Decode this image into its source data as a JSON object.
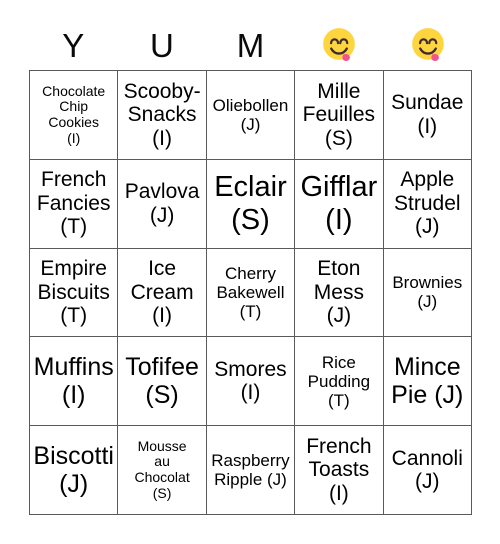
{
  "card": {
    "title_letters": [
      "Y",
      "U",
      "M",
      "😋",
      "😋"
    ],
    "header": {
      "col1": "Y",
      "col2": "U",
      "col3": "M",
      "col4": "😋",
      "col5": "😋"
    },
    "icons": {
      "col4_icon": "face-savoring-food-emoji",
      "col5_icon": "face-savoring-food-emoji"
    },
    "colors": {
      "background": "#ffffff",
      "text": "#000000",
      "grid_border": "#5a5a5a",
      "emoji_face": "#fcd53f",
      "emoji_tongue": "#f4538f"
    },
    "grid": {
      "rows": 5,
      "columns": 5,
      "cells": [
        [
          {
            "text": "Chocolate Chip Cookies (I)",
            "line1": "Chocolate",
            "line2": "Chip",
            "line3": "Cookies",
            "line4": "(I)",
            "size": "fs-xs"
          },
          {
            "text": "Scooby-Snacks (I)",
            "line1": "Scooby-",
            "line2": "Snacks",
            "line3": "(I)",
            "line4": "",
            "size": "fs-md"
          },
          {
            "text": "Oliebollen (J)",
            "line1": "Oliebollen",
            "line2": "(J)",
            "line3": "",
            "line4": "",
            "size": "fs-sm"
          },
          {
            "text": "Mille Feuilles (S)",
            "line1": "Mille",
            "line2": "Feuilles",
            "line3": "(S)",
            "line4": "",
            "size": "fs-md"
          },
          {
            "text": "Sundae (I)",
            "line1": "Sundae",
            "line2": "(I)",
            "line3": "",
            "line4": "",
            "size": "fs-md"
          }
        ],
        [
          {
            "text": "French Fancies (T)",
            "line1": "French",
            "line2": "Fancies",
            "line3": "(T)",
            "line4": "",
            "size": "fs-md"
          },
          {
            "text": "Pavlova (J)",
            "line1": "Pavlova",
            "line2": "(J)",
            "line3": "",
            "line4": "",
            "size": "fs-md"
          },
          {
            "text": "Eclair (S)",
            "line1": "Eclair",
            "line2": "(S)",
            "line3": "",
            "line4": "",
            "size": "fs-xl"
          },
          {
            "text": "Gifflar (I)",
            "line1": "Gifflar",
            "line2": "(I)",
            "line3": "",
            "line4": "",
            "size": "fs-xl"
          },
          {
            "text": "Apple Strudel (J)",
            "line1": "Apple",
            "line2": "Strudel",
            "line3": "(J)",
            "line4": "",
            "size": "fs-md"
          }
        ],
        [
          {
            "text": "Empire Biscuits (T)",
            "line1": "Empire",
            "line2": "Biscuits",
            "line3": "(T)",
            "line4": "",
            "size": "fs-md"
          },
          {
            "text": "Ice Cream (I)",
            "line1": "Ice",
            "line2": "Cream",
            "line3": "(I)",
            "line4": "",
            "size": "fs-md"
          },
          {
            "text": "Cherry Bakewell (T)",
            "line1": "Cherry",
            "line2": "Bakewell",
            "line3": "(T)",
            "line4": "",
            "size": "fs-sm"
          },
          {
            "text": "Eton Mess (J)",
            "line1": "Eton",
            "line2": "Mess",
            "line3": "(J)",
            "line4": "",
            "size": "fs-md"
          },
          {
            "text": "Brownies (J)",
            "line1": "Brownies",
            "line2": "(J)",
            "line3": "",
            "line4": "",
            "size": "fs-sm"
          }
        ],
        [
          {
            "text": "Muffins (I)",
            "line1": "Muffins",
            "line2": "(I)",
            "line3": "",
            "line4": "",
            "size": "fs-lg"
          },
          {
            "text": "Tofifee (S)",
            "line1": "Tofifee",
            "line2": "(S)",
            "line3": "",
            "line4": "",
            "size": "fs-lg"
          },
          {
            "text": "Smores (I)",
            "line1": "Smores",
            "line2": "(I)",
            "line3": "",
            "line4": "",
            "size": "fs-md"
          },
          {
            "text": "Rice Pudding (T)",
            "line1": "Rice",
            "line2": "Pudding",
            "line3": "(T)",
            "line4": "",
            "size": "fs-sm"
          },
          {
            "text": "Mince Pie (J)",
            "line1": "Mince",
            "line2": "Pie (J)",
            "line3": "",
            "line4": "",
            "size": "fs-lg"
          }
        ],
        [
          {
            "text": "Biscotti (J)",
            "line1": "Biscotti",
            "line2": "(J)",
            "line3": "",
            "line4": "",
            "size": "fs-lg"
          },
          {
            "text": "Mousse au Chocolat (S)",
            "line1": "Mousse",
            "line2": "au",
            "line3": "Chocolat",
            "line4": "(S)",
            "size": "fs-xs"
          },
          {
            "text": "Raspberry Ripple (J)",
            "line1": "Raspberry",
            "line2": "Ripple (J)",
            "line3": "",
            "line4": "",
            "size": "fs-sm"
          },
          {
            "text": "French Toasts (I)",
            "line1": "French",
            "line2": "Toasts",
            "line3": "(I)",
            "line4": "",
            "size": "fs-md"
          },
          {
            "text": "Cannoli (J)",
            "line1": "Cannoli",
            "line2": "(J)",
            "line3": "",
            "line4": "",
            "size": "fs-md"
          }
        ]
      ]
    }
  }
}
